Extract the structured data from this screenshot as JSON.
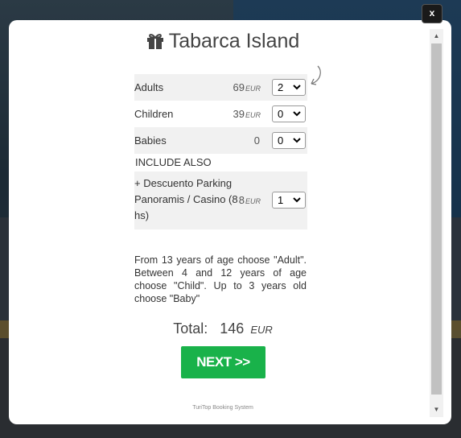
{
  "modal": {
    "close_label": "x",
    "title": "Tabarca Island",
    "title_icon": "gift-icon"
  },
  "booking": {
    "rows": [
      {
        "label": "Adults",
        "price": "69",
        "currency": "EUR",
        "selected": "2"
      },
      {
        "label": "Children",
        "price": "39",
        "currency": "EUR",
        "selected": "0"
      },
      {
        "label": "Babies",
        "price": "0",
        "currency": "",
        "selected": "0"
      }
    ],
    "include_header": "INCLUDE ALSO",
    "extras": [
      {
        "label": "+ Descuento Parking Panoramis / Casino (8 hs)",
        "price": "8",
        "currency": "EUR",
        "selected": "1"
      }
    ]
  },
  "help_text": "From 13 years of age choose \"Adult\". Between 4 and 12 years of age choose \"Child\". Up to 3 years old choose \"Baby\"",
  "total": {
    "label": "Total:",
    "amount": "146",
    "currency": "EUR"
  },
  "next_button": "NEXT >>",
  "footer": "TuriTop Booking System",
  "colors": {
    "accent": "#19b24a",
    "row_shade": "#f1f1f1"
  }
}
